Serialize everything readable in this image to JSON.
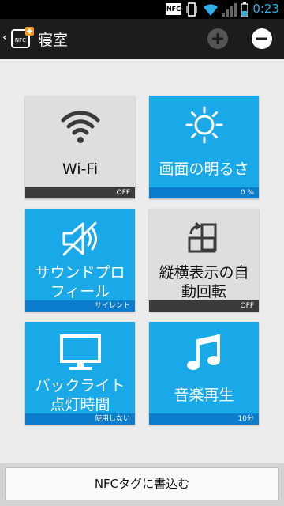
{
  "status_bar": {
    "nfc_label": "NFC",
    "time": "0:23",
    "icons": [
      "nfc-icon",
      "vibrate-icon",
      "wifi-icon",
      "signal-icon",
      "battery-icon"
    ]
  },
  "action_bar": {
    "title": "寝室",
    "back_glyph": "‹",
    "icons": [
      "app-nfc-icon",
      "add-icon",
      "remove-icon"
    ]
  },
  "tiles": [
    {
      "label": "Wi-Fi",
      "status": "OFF",
      "icon": "wifi-icon",
      "state": "off"
    },
    {
      "label": "画面の明るさ",
      "status": "0 %",
      "icon": "brightness-icon",
      "state": "on"
    },
    {
      "label_lines": [
        "サウンドプロ",
        "フィール"
      ],
      "status": "サイレント",
      "icon": "speaker-mute-icon",
      "state": "on"
    },
    {
      "label_lines": [
        "縦横表示の自",
        "動回転"
      ],
      "status": "OFF",
      "icon": "rotate-icon",
      "state": "off"
    },
    {
      "label_lines": [
        "バックライト",
        "点灯時間"
      ],
      "status": "使用しない",
      "icon": "monitor-icon",
      "state": "on"
    },
    {
      "label": "音楽再生",
      "status": "10分",
      "icon": "music-note-icon",
      "state": "on"
    }
  ],
  "bottom": {
    "write_button": "NFCタグに書込む"
  },
  "colors": {
    "tile_on": "#1aa9e8",
    "tile_off": "#dedede",
    "status_on": "#0c7ccc",
    "status_off": "#3b3b3b",
    "accent": "#2ab0e6"
  }
}
